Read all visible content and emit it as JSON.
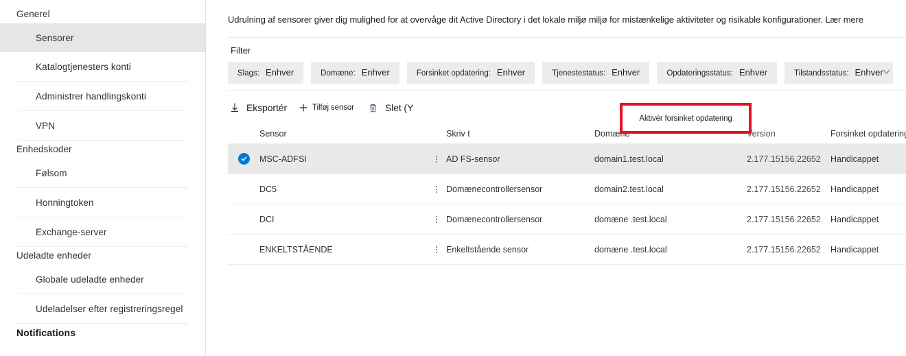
{
  "sidebar": {
    "groups": [
      {
        "title": "Generel",
        "bold": false
      },
      {
        "title": "Enhedskoder",
        "bold": false
      },
      {
        "title": "Udeladte enheder",
        "bold": false
      },
      {
        "title": "Notifications",
        "bold": true
      }
    ],
    "items": [
      {
        "label": "Sensorer",
        "selected": true
      },
      {
        "label": "Katalogtjenesters konti",
        "selected": false
      },
      {
        "label": "Administrer handlingskonti",
        "selected": false
      },
      {
        "label": "VPN",
        "selected": false
      },
      {
        "label": "Følsom",
        "selected": false
      },
      {
        "label": "Honningtoken",
        "selected": false
      },
      {
        "label": "Exchange-server",
        "selected": false
      },
      {
        "label": "Globale udeladte enheder",
        "selected": false
      },
      {
        "label": "Udeladelser efter registreringsregel",
        "selected": false
      }
    ]
  },
  "description": {
    "text": "Udrulning af sensorer giver dig mulighed for at overvåge dit Active Directory i det lokale miljø miljø for mistænkelige aktiviteter og risikable konfigurationer.",
    "link_label": "Lær mere"
  },
  "filter": {
    "label": "Filter",
    "pills": [
      {
        "key": "Slags:",
        "value": "Enhver",
        "caret": false
      },
      {
        "key": "Domæne:",
        "value": "Enhver",
        "caret": false
      },
      {
        "key": "Forsinket opdatering:",
        "value": "Enhver",
        "caret": false
      },
      {
        "key": "Tjenestestatus:",
        "value": "Enhver",
        "caret": false
      },
      {
        "key": "Opdateringsstatus:",
        "value": "Enhver",
        "caret": false
      },
      {
        "key": "Tilstandsstatus:",
        "value": "Enhver",
        "caret": true
      }
    ]
  },
  "commandbar": {
    "export_label": "Eksportér",
    "export_icon": "download-arrow-icon",
    "add_sensor_label": "Tilføj sensor",
    "add_icon": "plus-icon",
    "delete_label": "Slet (Y",
    "delete_icon": "trash-icon",
    "highlight_label": "Aktivér forsinket opdatering",
    "highlight_color": "#e81123"
  },
  "table": {
    "columns": [
      "Sensor",
      "Skriv t",
      "Domæne",
      "Version",
      "Forsinket opdatering"
    ],
    "rows": [
      {
        "name": "MSC-ADFSI",
        "type": "AD FS-sensor",
        "domain": "domain1.test.local",
        "version": "2.177.15156.22652",
        "delayed_update": "Handicappet",
        "selected": true
      },
      {
        "name": "DC5",
        "type": "Domænecontrollersensor",
        "domain": "domain2.test.local",
        "version": "2.177.15156.22652",
        "delayed_update": "Handicappet",
        "selected": false
      },
      {
        "name": "DCI",
        "type": "Domænecontrollersensor",
        "domain": "domæne .test.local",
        "version": "2.177.15156.22652",
        "delayed_update": "Handicappet",
        "selected": false
      },
      {
        "name": "ENKELTSTÅENDE",
        "type": "Enkeltstående sensor",
        "domain": "domæne .test.local",
        "version": "2.177.15156.22652",
        "delayed_update": "Handicappet",
        "selected": false
      }
    ]
  },
  "colors": {
    "accent": "#0078d4",
    "selected_row": "#e9e9e9",
    "pill_bg": "#ececec",
    "annotation": "#e81123"
  }
}
